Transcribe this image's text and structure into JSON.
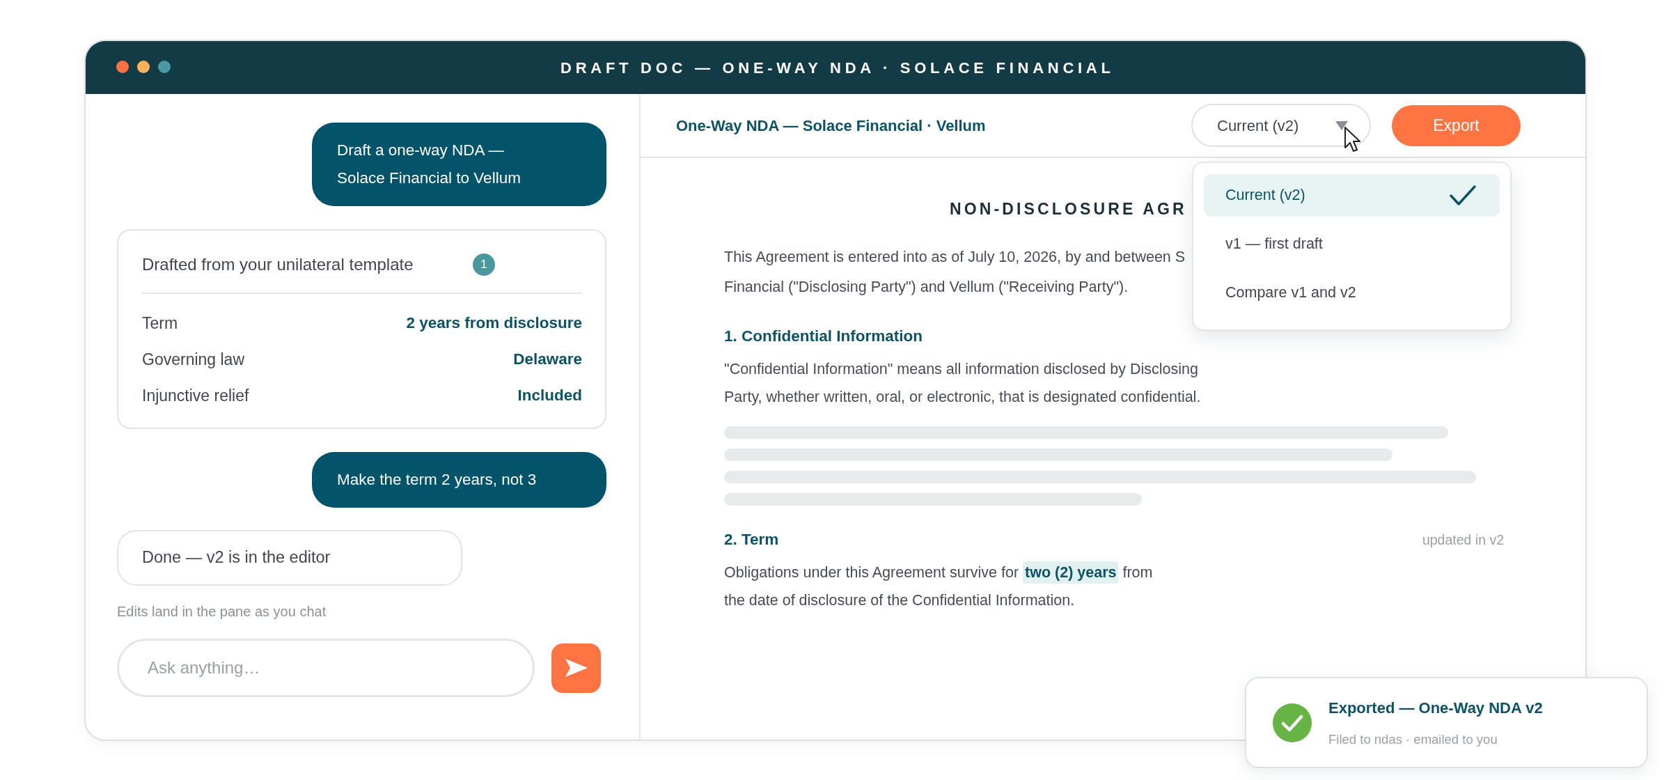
{
  "window": {
    "title": "DRAFT DOC — ONE-WAY NDA · SOLACE FINANCIAL",
    "controls": [
      {
        "color": "#ff7043"
      },
      {
        "color": "#fdb25a"
      },
      {
        "color": "#4a9aa3"
      }
    ]
  },
  "chat": {
    "messages": [
      {
        "kind": "user",
        "text": "Draft a one-way NDA — Solace Financial to Vellum"
      },
      {
        "kind": "summary",
        "title": "Drafted from your unilateral template",
        "badge": "1",
        "rows": [
          {
            "label": "Term",
            "value": "2 years from disclosure"
          },
          {
            "label": "Governing law",
            "value": "Delaware"
          },
          {
            "label": "Injunctive relief",
            "value": "Included"
          }
        ]
      },
      {
        "kind": "user",
        "text": "Make the term 2 years, not 3"
      },
      {
        "kind": "assistant",
        "text": "Done — v2 is in the editor"
      }
    ],
    "caption": "Edits land in the pane as you chat",
    "composer": {
      "placeholder": "Ask anything…"
    }
  },
  "editor": {
    "title": "One-Way NDA — Solace Financial · Vellum",
    "version_select": {
      "value": "Current (v2)",
      "expanded": true
    },
    "export_button": "Export",
    "version_menu": [
      {
        "label": "Current (v2)",
        "selected": true
      },
      {
        "label": "v1 — first draft",
        "selected": false
      },
      {
        "label": "Compare v1 and v2",
        "selected": false
      }
    ],
    "document": {
      "title": "NON-DISCLOSURE AGR",
      "intro": [
        "This Agreement is entered into as of July 10, 2026, by and between S",
        "Financial (\"Disclosing Party\") and Vellum (\"Receiving Party\")."
      ],
      "sections": [
        {
          "heading": "1. Confidential Information",
          "lines": [
            "\"Confidential Information\" means all information disclosed by Disclosing",
            "Party, whether written, oral, or electronic, that is designated confidential."
          ],
          "placeholder_bars": true
        },
        {
          "heading": "2. Term",
          "note": "updated in v2",
          "lines": [
            "Obligations under this Agreement survive for **two (2) years** from",
            "the date of disclosure of the Confidential Information."
          ]
        }
      ]
    }
  },
  "toast": {
    "title": "Exported — One-Way NDA v2",
    "detail": "Filed to ndas · emailed to you"
  }
}
